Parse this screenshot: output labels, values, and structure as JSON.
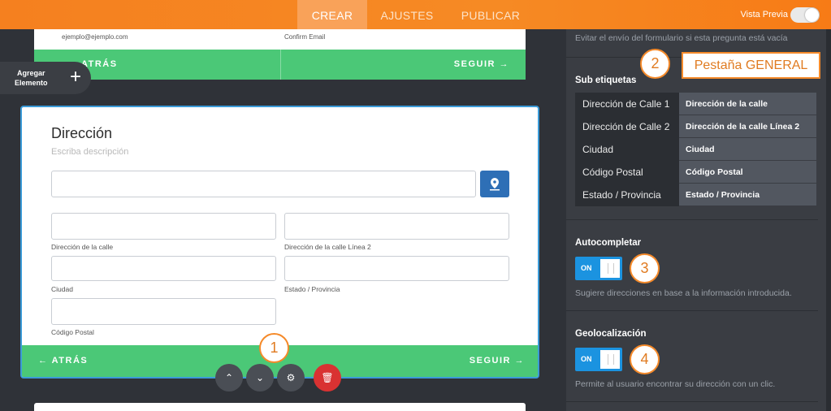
{
  "topbar": {
    "tabs": [
      "CREAR",
      "AJUSTES",
      "PUBLICAR"
    ],
    "active_tab": "CREAR",
    "preview_label": "Vista Previa",
    "accent": "#f5801f"
  },
  "canvas": {
    "prev_card": {
      "email_hint": "ejemplo@ejemplo.com",
      "confirm_label": "Confirm Email",
      "back_label": "ATRÁS",
      "next_label": "SEGUIR →"
    },
    "add_element": {
      "label_line1": "Agregar",
      "label_line2": "Elemento",
      "plus": "+"
    },
    "address_card": {
      "title": "Dirección",
      "description": "Escriba descripción",
      "street_label": "Dirección de la calle",
      "street2_label": "Dirección de la calle Línea 2",
      "city_label": "Ciudad",
      "state_label": "Estado / Provincia",
      "postal_label": "Código Postal",
      "back_label": "← ATRÁS",
      "next_label": "SEGUIR →"
    },
    "controls": {
      "up": "⌃",
      "down": "⌄",
      "settings": "⚙",
      "delete": "🗑"
    },
    "callout_1": "1"
  },
  "panel": {
    "required_hint": "Evitar el envío del formulario si esta pregunta está vacía",
    "callout_2": "2",
    "general_tab_tag": "Pestaña GENERAL",
    "sublabels_heading": "Sub etiquetas",
    "sublabels": [
      {
        "key": "Dirección de Calle 1",
        "value": "Dirección de la calle"
      },
      {
        "key": "Dirección de Calle 2",
        "value": "Dirección de la calle Línea 2"
      },
      {
        "key": "Ciudad",
        "value": "Ciudad"
      },
      {
        "key": "Código Postal",
        "value": "Código Postal"
      },
      {
        "key": "Estado / Provincia",
        "value": "Estado / Provincia"
      }
    ],
    "autocomplete": {
      "heading": "Autocompletar",
      "state": "ON",
      "hint": "Sugiere direcciones en base a la información introducida.",
      "callout": "3"
    },
    "geolocation": {
      "heading": "Geolocalización",
      "state": "ON",
      "hint": "Permite al usuario encontrar su dirección con un clic.",
      "callout": "4"
    }
  }
}
